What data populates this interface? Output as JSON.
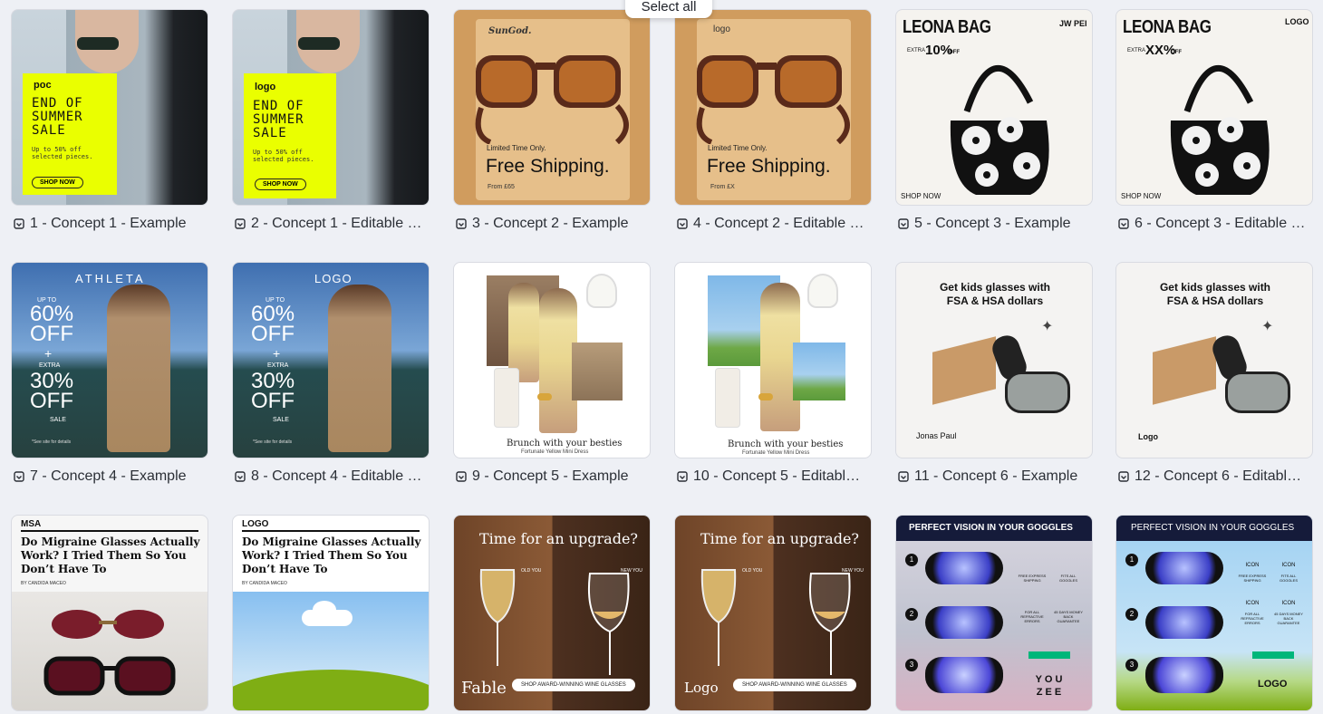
{
  "toolbar": {
    "select_all": "Select all"
  },
  "cards": [
    {
      "label": "1 - Concept 1 - Example",
      "brand": "poc",
      "headline": "END OF SUMMER SALE",
      "sub": "Up to 50% off selected pieces.",
      "cta": "SHOP NOW"
    },
    {
      "label": "2 - Concept 1 - Editable 1…",
      "brand": "logo",
      "headline": "END OF SUMMER SALE",
      "sub": "Up to 50% off selected pieces.",
      "cta": "SHOP NOW"
    },
    {
      "label": "3 - Concept 2 - Example",
      "brand": "SunGod.",
      "eyebrow": "Limited Time Only.",
      "headline": "Free Shipping.",
      "sub": "From £65"
    },
    {
      "label": "4 - Concept 2 - Editable …",
      "brand": "logo",
      "eyebrow": "Limited Time Only.",
      "headline": "Free Shipping.",
      "sub": "From £X"
    },
    {
      "label": "5 - Concept 3 - Example",
      "brand": "JW PEI",
      "headline": "LEONA BAG",
      "offer_small": "EXTRA",
      "offer": "10%",
      "offer_off": "OFF",
      "cta": "SHOP NOW"
    },
    {
      "label": "6 - Concept 3 - Editable …",
      "brand": "LOGO",
      "headline": "LEONA BAG",
      "offer_small": "EXTRA",
      "offer": "XX%",
      "offer_off": "OFF",
      "cta": "SHOP NOW"
    },
    {
      "label": "7 - Concept 4 - Example",
      "brand": "ATHLETA",
      "upto": "UP TO",
      "big1": "60% OFF",
      "plus": "+",
      "extra": "EXTRA",
      "big2": "30% OFF",
      "sale": "SALE",
      "fine": "*See site for details"
    },
    {
      "label": "8 - Concept 4 - Editable …",
      "brand": "LOGO",
      "upto": "UP TO",
      "big1": "60% OFF",
      "plus": "+",
      "extra": "EXTRA",
      "big2": "30% OFF",
      "sale": "SALE",
      "fine": "*See site for details"
    },
    {
      "label": "9 - Concept 5 - Example",
      "headline": "Brunch with your besties",
      "sub": "Fortunate Yellow Mini Dress"
    },
    {
      "label": "10 - Concept 5 - Editable…",
      "headline": "Brunch with your besties",
      "sub": "Fortunate Yellow Mini Dress"
    },
    {
      "label": "11 - Concept 6 - Example",
      "headline": "Get kids glasses with FSA & HSA dollars",
      "brand": "Jonas Paul"
    },
    {
      "label": "12 - Concept 6 - Editable…",
      "headline": "Get kids glasses with FSA & HSA dollars",
      "brand": "Logo"
    },
    {
      "label": "",
      "brand": "MSA",
      "headline": "Do Migraine Glasses Actually Work? I Tried Them So You Don’t Have To",
      "byline": "BY CANDIDA MACEO"
    },
    {
      "label": "",
      "brand": "LOGO",
      "headline": "Do Migraine Glasses Actually Work? I Tried Them So You Don’t Have To",
      "byline": "BY CANDIDA MACEO"
    },
    {
      "label": "",
      "headline": "Time for an upgrade?",
      "old": "OLD YOU",
      "new": "NEW YOU",
      "brand": "Fable",
      "cta": "SHOP AWARD-WINNING WINE GLASSES"
    },
    {
      "label": "",
      "headline": "Time for an upgrade?",
      "old": "OLD YOU",
      "new": "NEW YOU",
      "brand": "Logo",
      "cta": "SHOP AWARD-WINNING WINE GLASSES"
    },
    {
      "label": "",
      "headline": "PERFECT VISION IN YOUR GOGGLES",
      "f1": "FREE EXPRESS SHIPPING",
      "f2": "FITS ALL GOGGLES",
      "f3": "FOR ALL REFRACTIVE ERRORS",
      "f4": "45 DAYS MONEY BACK GUARANTEE",
      "brand": "YOU ZEE",
      "n1": "1",
      "n2": "2",
      "n3": "3"
    },
    {
      "label": "",
      "headline": "PERFECT VISION IN YOUR GOGGLES",
      "f1": "FREE EXPRESS SHIPPING",
      "f2": "FITS ALL GOGGLES",
      "f3": "FOR ALL REFRACTIVE ERRORS",
      "f4": "45 DAYS MONEY BACK GUARANTEE",
      "icon_word": "ICON",
      "brand": "LOGO",
      "n1": "1",
      "n2": "2",
      "n3": "3"
    }
  ]
}
